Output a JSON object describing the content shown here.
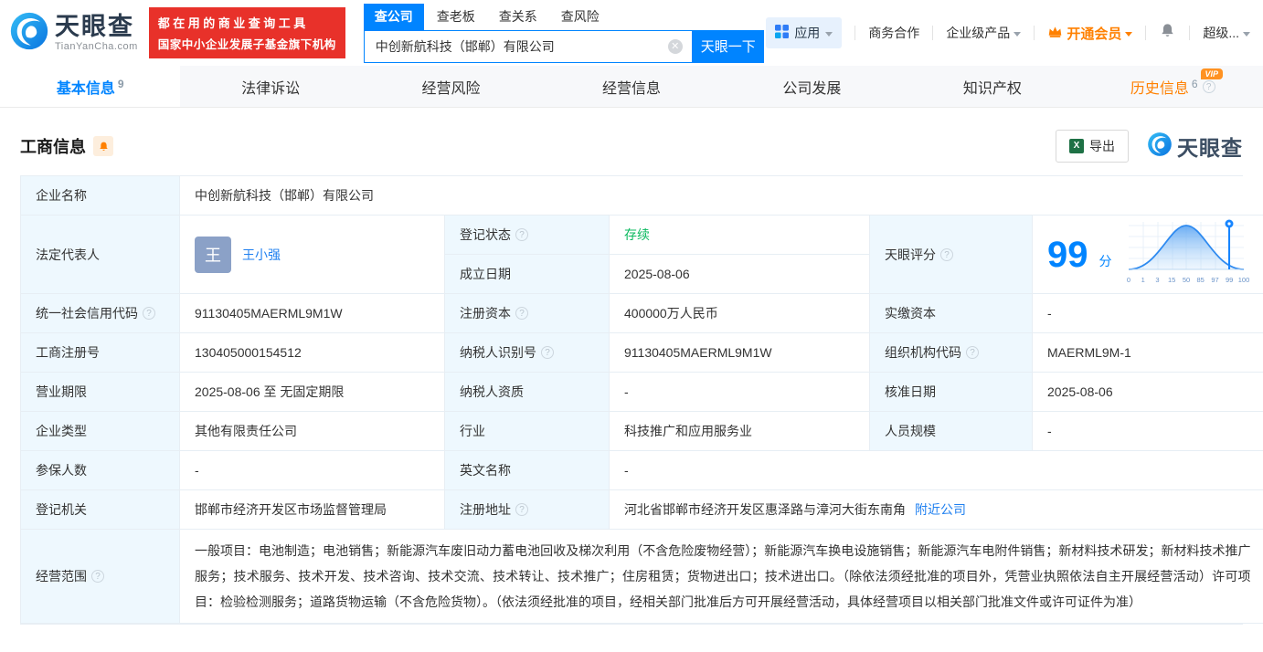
{
  "brand": {
    "name": "天眼查",
    "domain": "TianYanCha.com",
    "slogan1": "都在用的商业查询工具",
    "slogan2": "国家中小企业发展子基金旗下机构"
  },
  "search": {
    "tab_company": "查公司",
    "tab_boss": "查老板",
    "tab_relation": "查关系",
    "tab_risk": "查风险",
    "input_value": "中创新航科技（邯郸）有限公司",
    "button": "天眼一下"
  },
  "menu": {
    "apps": "应用",
    "cooperation": "商务合作",
    "enterprise": "企业级产品",
    "vip": "开通会员",
    "account": "超级..."
  },
  "tabs": {
    "basic": "基本信息",
    "basic_count": "9",
    "legal": "法律诉讼",
    "risk": "经营风险",
    "operation": "经营信息",
    "development": "公司发展",
    "ip": "知识产权",
    "history": "历史信息",
    "history_count": "6",
    "vip_badge": "VIP"
  },
  "section": {
    "title": "工商信息",
    "export_label": "导出",
    "watermark": "天眼查"
  },
  "fields": {
    "company_name": {
      "label": "企业名称",
      "value": "中创新航科技（邯郸）有限公司"
    },
    "legal_rep": {
      "label": "法定代表人",
      "avatar_char": "王",
      "name": "王小强"
    },
    "reg_status": {
      "label": "登记状态",
      "value": "存续"
    },
    "establish_date": {
      "label": "成立日期",
      "value": "2025-08-06"
    },
    "score": {
      "label": "天眼评分",
      "value": "99",
      "unit": "分",
      "ticks": [
        "0",
        "1",
        "3",
        "15",
        "50",
        "85",
        "97",
        "99",
        "100"
      ]
    },
    "credit_code": {
      "label": "统一社会信用代码",
      "value": "91130405MAERML9M1W"
    },
    "reg_capital": {
      "label": "注册资本",
      "value": "400000万人民币"
    },
    "paid_capital": {
      "label": "实缴资本",
      "value": "-"
    },
    "reg_number": {
      "label": "工商注册号",
      "value": "130405000154512"
    },
    "taxpayer_id": {
      "label": "纳税人识别号",
      "value": "91130405MAERML9M1W"
    },
    "org_code": {
      "label": "组织机构代码",
      "value": "MAERML9M-1"
    },
    "business_term": {
      "label": "营业期限",
      "value": "2025-08-06 至 无固定期限"
    },
    "taxpayer_quality": {
      "label": "纳税人资质",
      "value": "-"
    },
    "approval_date": {
      "label": "核准日期",
      "value": "2025-08-06"
    },
    "company_type": {
      "label": "企业类型",
      "value": "其他有限责任公司"
    },
    "industry": {
      "label": "行业",
      "value": "科技推广和应用服务业"
    },
    "staff_size": {
      "label": "人员规模",
      "value": "-"
    },
    "insured_count": {
      "label": "参保人数",
      "value": "-"
    },
    "english_name": {
      "label": "英文名称",
      "value": "-"
    },
    "reg_authority": {
      "label": "登记机关",
      "value": "邯郸市经济开发区市场监督管理局"
    },
    "reg_address": {
      "label": "注册地址",
      "value": "河北省邯郸市经济开发区惠泽路与漳河大街东南角",
      "link": "附近公司"
    },
    "business_scope": {
      "label": "经营范围",
      "value": "一般项目：电池制造；电池销售；新能源汽车废旧动力蓄电池回收及梯次利用（不含危险废物经营）；新能源汽车换电设施销售；新能源汽车电附件销售；新材料技术研发；新材料技术推广服务；技术服务、技术开发、技术咨询、技术交流、技术转让、技术推广；住房租赁；货物进出口；技术进出口。（除依法须经批准的项目外，凭营业执照依法自主开展经营活动）许可项目：检验检测服务；道路货物运输（不含危险货物）。（依法须经批准的项目，经相关部门批准后方可开展经营活动，具体经营项目以相关部门批准文件或许可证件为准）"
    }
  },
  "colors": {
    "accent": "#0084ff",
    "orange": "#ff8000",
    "green": "#0bb95f",
    "red": "#e8312a"
  }
}
